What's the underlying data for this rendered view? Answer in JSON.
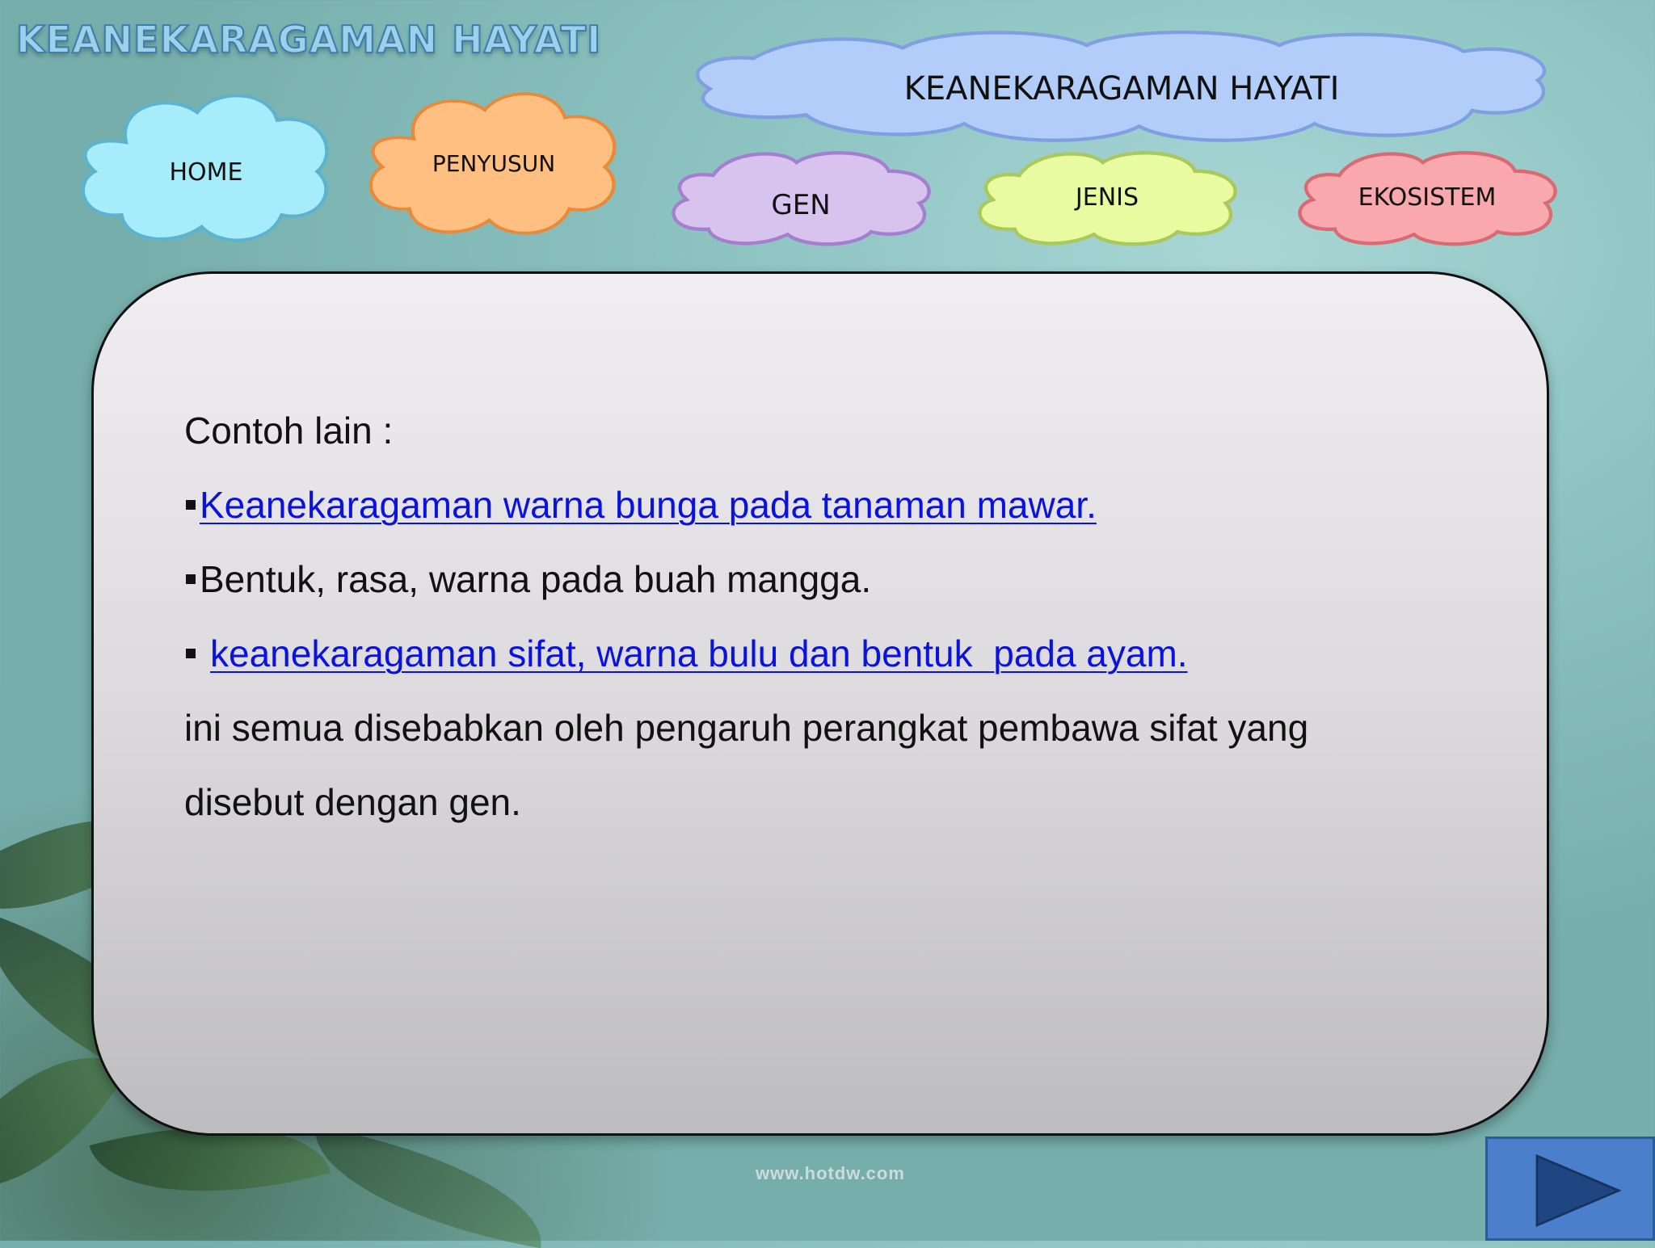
{
  "app": {
    "title": "KEANEKARAGAMAN HAYATI",
    "watermark": "www.hotdw.com"
  },
  "nav": {
    "home": "HOME",
    "penyusun": "PENYUSUN",
    "main_topic": "KEANEKARAGAMAN HAYATI",
    "gen": "GEN",
    "jenis": "JENIS",
    "ekosistem": "EKOSISTEM"
  },
  "content": {
    "heading": "Contoh lain :",
    "items": [
      "Keanekaragaman warna bunga pada tanaman mawar.",
      "Bentuk, rasa, warna pada buah mangga.",
      "keanekaragaman sifat, warna bulu dan bentuk  pada ayam."
    ],
    "conclusion_line1": "ini semua disebabkan oleh pengaruh perangkat pembawa sifat yang",
    "conclusion_line2": "disebut dengan gen."
  },
  "icons": {
    "next": "play-triangle-icon"
  },
  "colors": {
    "link": "#0a12e0",
    "home_cloud": "#a6ecfb",
    "penyusun_cloud": "#ffbf80",
    "main_cloud": "#b3cdfb",
    "gen_cloud": "#d7c3ee",
    "jenis_cloud": "#e8fba0",
    "ekosistem_cloud": "#f9a9ad",
    "next_button": "#4a7fcb"
  }
}
